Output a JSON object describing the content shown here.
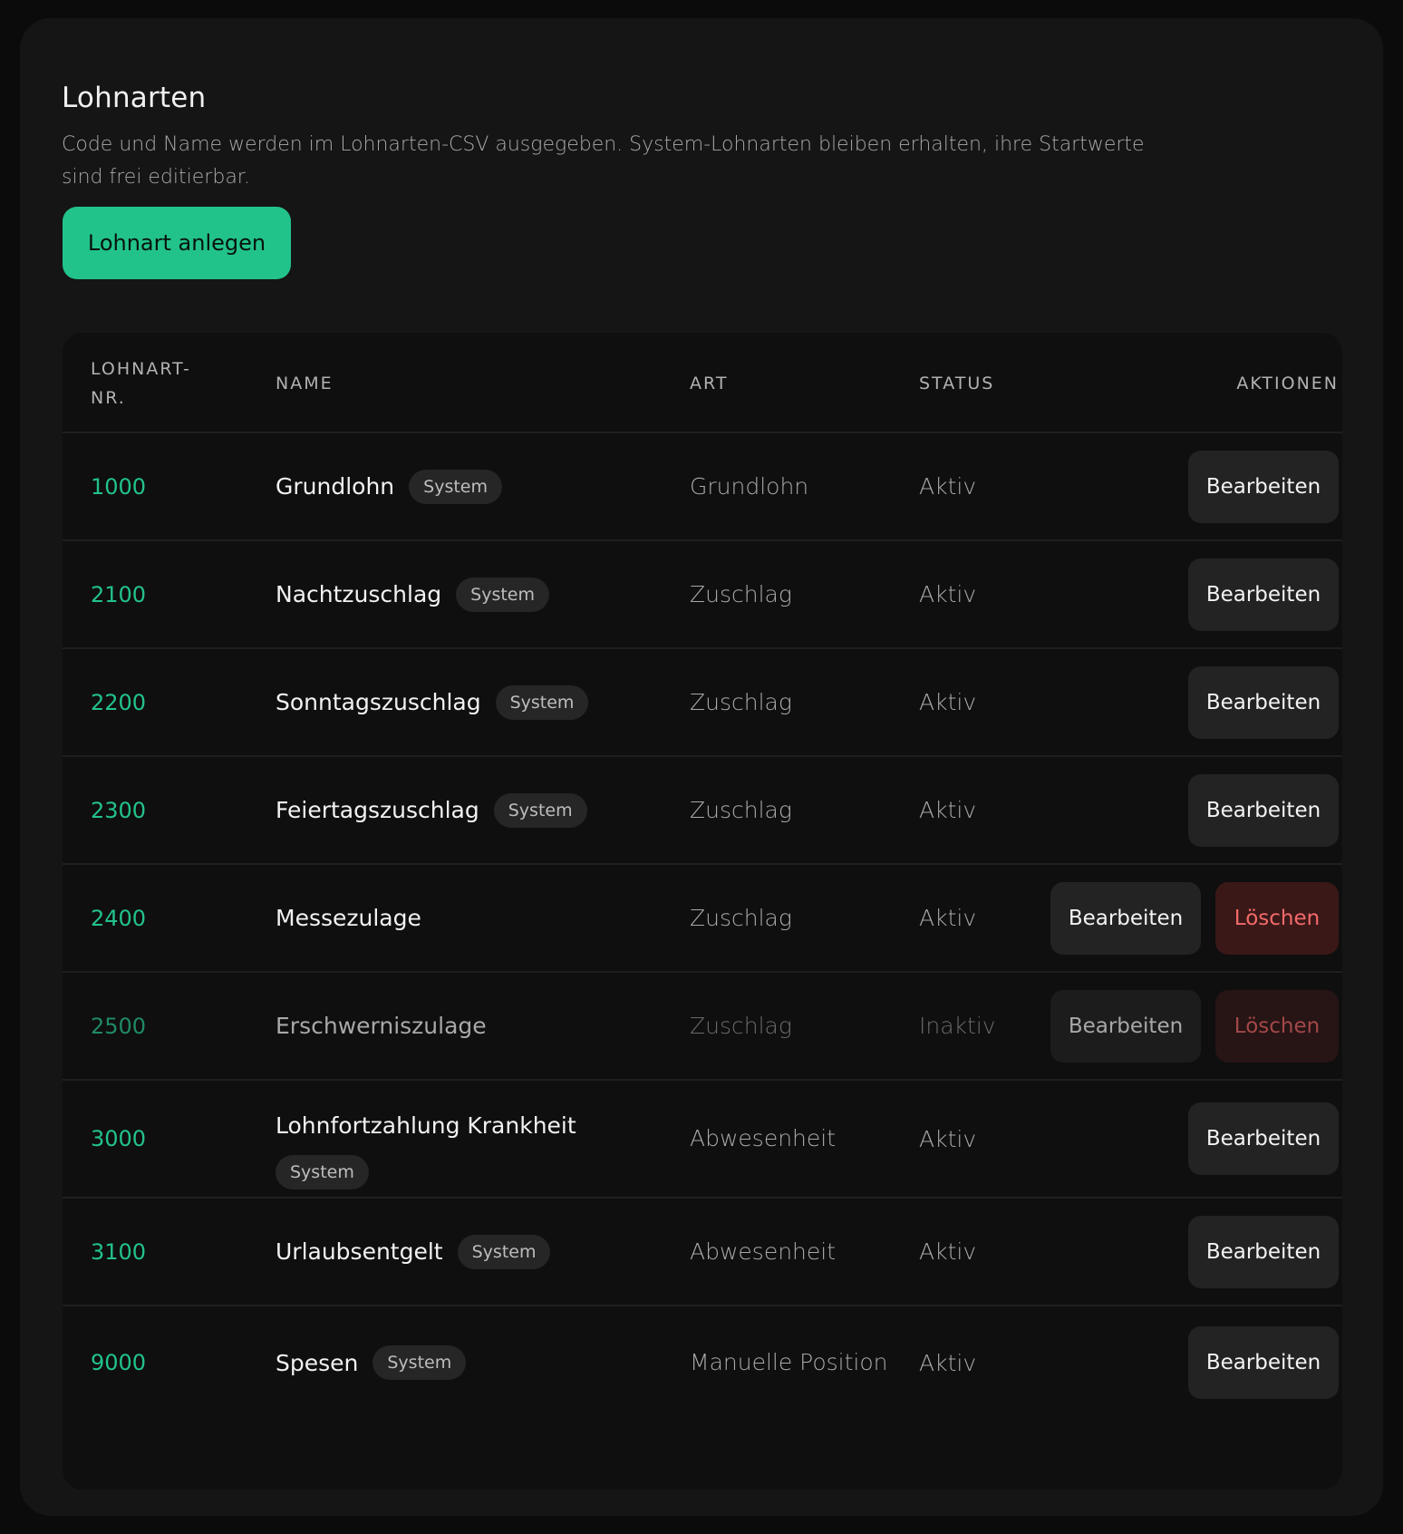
{
  "page": {
    "title": "Lohnarten",
    "description": "Code und Name werden im Lohnarten-CSV ausgegeben. System-Lohnarten bleiben erhalten, ihre Startwerte sind frei editierbar.",
    "create_button": "Lohnart anlegen"
  },
  "table": {
    "headers": {
      "code": "LOHNART-NR.",
      "name": "NAME",
      "type": "ART",
      "status": "STATUS",
      "actions": "AKTIONEN"
    },
    "edit_label": "Bearbeiten",
    "delete_label": "Löschen",
    "rows": [
      {
        "code": "1000",
        "name": "Grundlohn",
        "badge": "System",
        "type": "Grundlohn",
        "status": "Aktiv"
      },
      {
        "code": "2100",
        "name": "Nachtzuschlag",
        "badge": "System",
        "type": "Zuschlag",
        "status": "Aktiv"
      },
      {
        "code": "2200",
        "name": "Sonntagszuschlag",
        "badge": "System",
        "type": "Zuschlag",
        "status": "Aktiv"
      },
      {
        "code": "2300",
        "name": "Feiertagszuschlag",
        "badge": "System",
        "type": "Zuschlag",
        "status": "Aktiv"
      },
      {
        "code": "2400",
        "name": "Messezulage",
        "type": "Zuschlag",
        "status": "Aktiv"
      },
      {
        "code": "2500",
        "name": "Erschwerniszulage",
        "type": "Zuschlag",
        "status": "Inaktiv"
      },
      {
        "code": "3000",
        "name": "Lohnfortzahlung Krankheit",
        "badge": "System",
        "type": "Abwesenheit",
        "status": "Aktiv"
      },
      {
        "code": "3100",
        "name": "Urlaubsentgelt",
        "badge": "System",
        "type": "Abwesenheit",
        "status": "Aktiv"
      },
      {
        "code": "9000",
        "name": "Spesen",
        "badge": "System",
        "type": "Manuelle Position",
        "status": "Aktiv"
      }
    ]
  }
}
